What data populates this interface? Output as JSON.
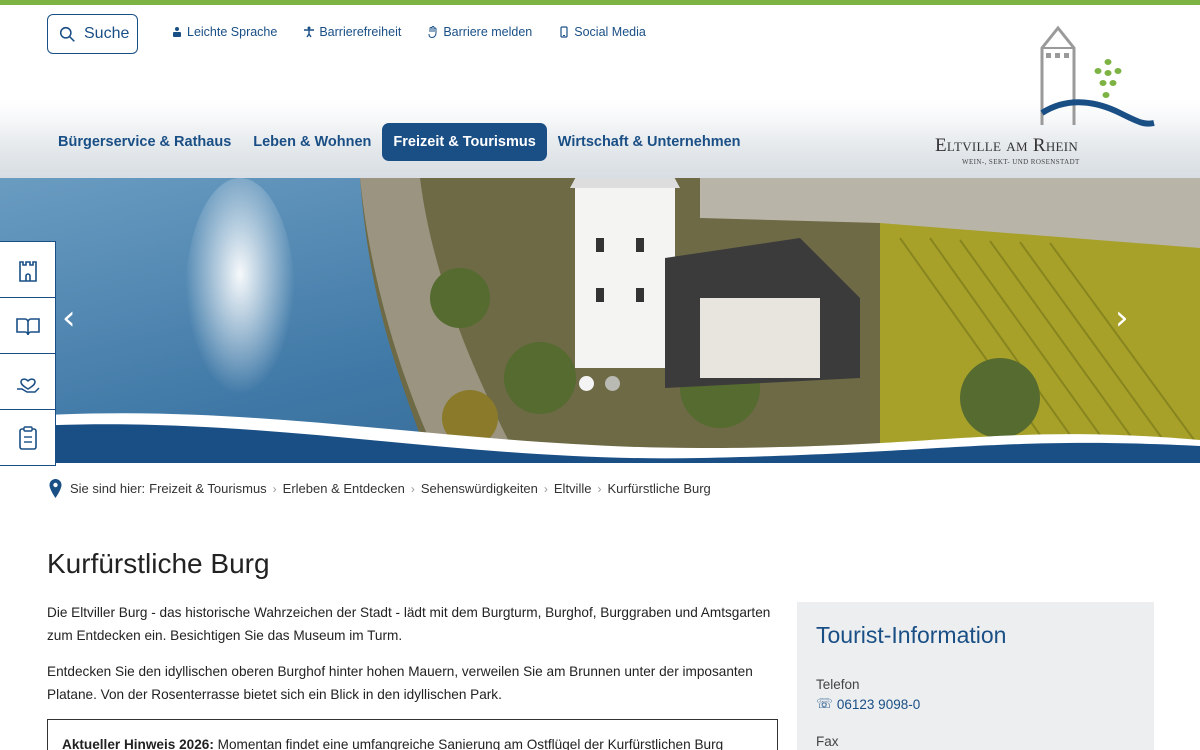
{
  "header": {
    "search_label": "Suche",
    "quicklinks": [
      {
        "label": "Leichte Sprache",
        "icon": "easy-language-icon"
      },
      {
        "label": "Barrierefreiheit",
        "icon": "accessibility-icon"
      },
      {
        "label": "Barriere melden",
        "icon": "report-hand-icon"
      },
      {
        "label": "Social Media",
        "icon": "phone-icon"
      }
    ],
    "nav": [
      {
        "label": "Bürgerservice & Rathaus"
      },
      {
        "label": "Leben & Wohnen"
      },
      {
        "label": "Freizeit & Tourismus"
      },
      {
        "label": "Wirtschaft & Unternehmen"
      }
    ],
    "logo_title": "Eltville am Rhein",
    "logo_subtitle": "WEIN-, SEKT- UND ROSENSTADT"
  },
  "hero": {
    "prev_symbol": "‹",
    "next_symbol": "›",
    "slide_count": 2,
    "active_slide": 1
  },
  "sidebar": [
    {
      "icon": "castle-icon"
    },
    {
      "icon": "book-icon"
    },
    {
      "icon": "hand-heart-icon"
    },
    {
      "icon": "clipboard-icon"
    }
  ],
  "breadcrumb": {
    "prefix": "Sie sind hier:",
    "items": [
      "Freizeit & Tourismus",
      "Erleben & Entdecken",
      "Sehenswürdigkeiten",
      "Eltville",
      "Kurfürstliche Burg"
    ]
  },
  "page": {
    "title": "Kurfürstliche Burg",
    "paragraph1": "Die Eltviller Burg - das historische Wahrzeichen der Stadt - lädt mit dem Burgturm, Burghof, Burggraben und Amtsgarten zum Entdecken ein. Besichtigen Sie das Museum im Turm.",
    "paragraph2": "Entdecken Sie den idyllischen oberen Burghof hinter hohen Mauern, verweilen Sie am Brunnen unter der imposanten Platane. Von der Rosenterrasse bietet sich ein Blick in den idyllischen Park.",
    "notice_label": "Aktueller Hinweis 2026:",
    "notice_text": " Momentan findet eine umfangreiche Sanierung am Ostflügel der Kurfürstlichen Burg"
  },
  "tourist_info": {
    "title": "Tourist-Information",
    "phone_label": "Telefon",
    "phone_value": "06123 9098-0",
    "fax_label": "Fax"
  },
  "colors": {
    "brand_blue": "#1a4f86",
    "accent_green": "#7cb342",
    "panel_grey": "#eceeef"
  }
}
